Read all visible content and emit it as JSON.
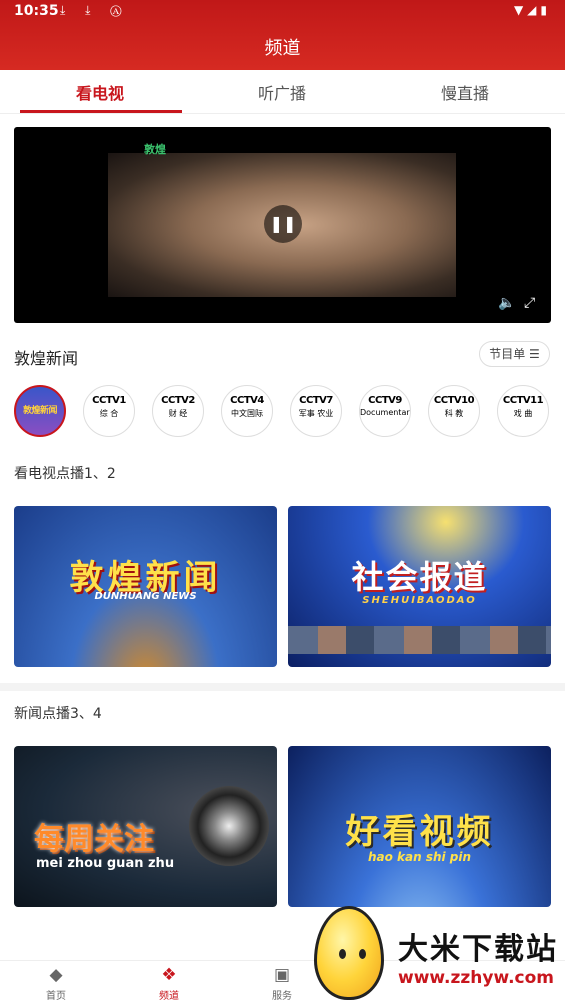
{
  "status_bar": {
    "time": "10:35",
    "left_icons": "⤓ ⤓ Ⓐ",
    "right_icons": "▼◢▮"
  },
  "header": {
    "title": "频道"
  },
  "tabs": [
    {
      "label": "看电视"
    },
    {
      "label": "听广播"
    },
    {
      "label": "慢直播"
    }
  ],
  "player": {
    "logo": "敦煌",
    "pause": "❚❚",
    "volume": "🔈",
    "fullscreen": "⤢"
  },
  "channel_section": {
    "title": "敦煌新闻",
    "schedule_label": "节目单 ☰"
  },
  "channels": [
    {
      "top": "敦煌新闻",
      "bottom": ""
    },
    {
      "top": "CCTV1",
      "bottom": "综 合"
    },
    {
      "top": "CCTV2",
      "bottom": "财 经"
    },
    {
      "top": "CCTV4",
      "bottom": "中文国际"
    },
    {
      "top": "CCTV7",
      "bottom": "军事 农业"
    },
    {
      "top": "CCTV9",
      "bottom": "Documentary"
    },
    {
      "top": "CCTV10",
      "bottom": "科 教"
    },
    {
      "top": "CCTV11",
      "bottom": "戏 曲"
    }
  ],
  "vod1": {
    "title": "看电视点播1、2",
    "items": [
      {
        "big": "敦煌新闻",
        "small": "DUNHUANG NEWS"
      },
      {
        "big": "社会报道",
        "small": "SHEHUIBAODAO"
      }
    ]
  },
  "vod2": {
    "title": "新闻点播3、4",
    "items": [
      {
        "big": "每周关注",
        "small": "mei zhou guan zhu"
      },
      {
        "big": "好看视频",
        "small": "hao kan shi pin"
      }
    ]
  },
  "tabbar": [
    {
      "icon": "◆",
      "label": "首页"
    },
    {
      "icon": "❖",
      "label": "频道"
    },
    {
      "icon": "▣",
      "label": "服务"
    }
  ],
  "watermark": {
    "text": "大米下载站",
    "url": "www.zzhyw.com"
  },
  "colors": {
    "accent": "#c8161d",
    "header": "#d62a22"
  }
}
